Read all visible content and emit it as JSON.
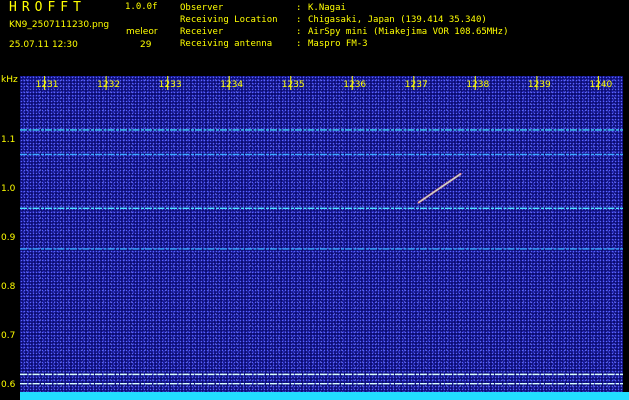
{
  "header": {
    "app_name": "HROFFT",
    "version": "1.0.0f",
    "filename": "KN9_2507111230.png",
    "program": "meleor",
    "timestamp": "25.07.11 12:30",
    "count": "29",
    "info": [
      {
        "label": "Observer",
        "value": "K.Nagai"
      },
      {
        "label": "Receiving Location",
        "value": "Chigasaki, Japan (139.414 35.340)"
      },
      {
        "label": "Receiver",
        "value": "AirSpy mini (Miakejima VOR 108.65MHz)"
      },
      {
        "label": "Receiving antenna",
        "value": "Maspro FM-3"
      }
    ]
  },
  "chart_data": {
    "type": "heatmap",
    "title": "",
    "xlabel": "",
    "ylabel": "kHz",
    "x_ticks": [
      "1231",
      "1232",
      "1233",
      "1234",
      "1235",
      "1236",
      "1237",
      "1238",
      "1239",
      "1240"
    ],
    "x_range": [
      1230.6,
      1240.4
    ],
    "y_ticks": [
      "1.1",
      "1.0",
      "0.9",
      "0.8",
      "0.7",
      "0.6"
    ],
    "y_range": [
      0.585,
      1.23
    ],
    "background_color": "#0b0c72",
    "horizontal_lines": [
      {
        "y": 1.12,
        "color": "#43d6ff"
      },
      {
        "y": 1.07,
        "color": "#3aa8ff"
      },
      {
        "y": 0.96,
        "color": "#4ee0ff"
      },
      {
        "y": 0.877,
        "color": "#3aa8ff"
      },
      {
        "y": 0.621,
        "color": "#d8ffff"
      },
      {
        "y": 0.602,
        "color": "#d8ffff"
      }
    ],
    "echoes": [
      {
        "x1": 1237.08,
        "y1": 0.972,
        "x2": 1237.76,
        "y2": 1.03,
        "color": "#ff8080"
      }
    ]
  }
}
